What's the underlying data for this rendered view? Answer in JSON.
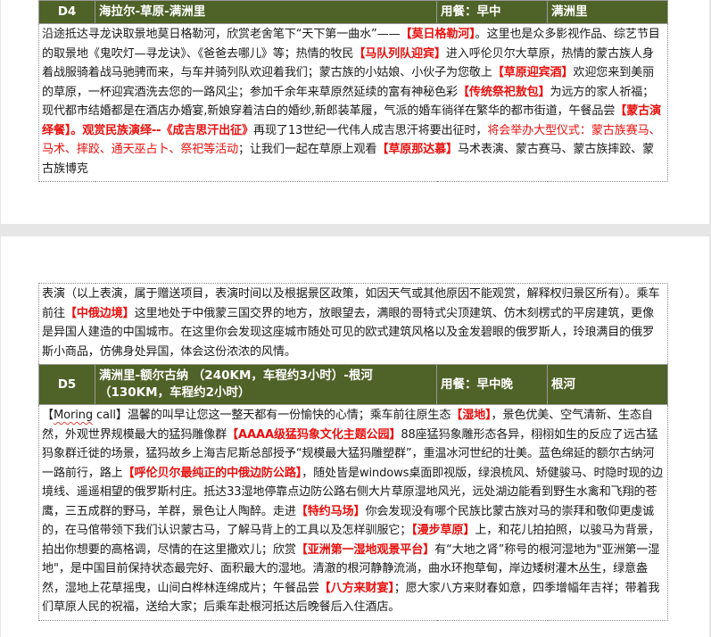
{
  "day4": {
    "day": "D4",
    "route": "海拉尔-草原-满洲里",
    "meals": "用餐：早中",
    "hotel": "满洲里",
    "segments": [
      {
        "t": "沿途抵达寻龙诀取景地莫日格勒河，欣赏老舍笔下“天下第一曲水”——",
        "s": "plain"
      },
      {
        "t": "【莫日格勒河】",
        "s": "hl"
      },
      {
        "t": "。这里也是众多影视作品、综艺节目的取景地《鬼吹灯—寻龙诀》、《爸爸去哪儿》等；热情的牧民",
        "s": "plain"
      },
      {
        "t": "【马队列队迎宾】",
        "s": "hl"
      },
      {
        "t": "进入呼伦贝尔大草原，热情的蒙古族人身着战服骑着战马驰骋而来，与车并骑列队欢迎着我们；蒙古族的小姑娘、小伙子为您敬上",
        "s": "plain"
      },
      {
        "t": "【草原迎宾酒】",
        "s": "hl"
      },
      {
        "t": "欢迎您来到美丽的草原，一杯迎宾酒洗去您的一路风尘；参加千余年来草原然延续的富有神秘色彩",
        "s": "plain"
      },
      {
        "t": "【传统祭祀敖包】",
        "s": "hl"
      },
      {
        "t": "为远方的家人祈福；现代都市结婚都是在酒店办婚宴,新娘穿着洁白的婚纱,新郎装革履，气派的婚车徜徉在繁华的都市街道，午餐品尝",
        "s": "plain"
      },
      {
        "t": "【蒙古演绎餐】",
        "s": "hl"
      },
      {
        "t": "。观赏民族演绎--",
        "s": "hl"
      },
      {
        "t": "《成吉思汗出征》",
        "s": "hl"
      },
      {
        "t": "再现了13世纪一代伟人成吉思汗将要出征时，",
        "s": "plain"
      },
      {
        "t": "将会举办大型仪式：蒙古族赛马、马术、摔跤、通天巫占卜、祭祀等活动",
        "s": "red"
      },
      {
        "t": "；让我们一起在草原上观看",
        "s": "plain"
      },
      {
        "t": "【草原那达慕】",
        "s": "hl"
      },
      {
        "t": "马术表演、蒙古赛马、蒙古族摔跤、蒙古族博克",
        "s": "plain"
      }
    ]
  },
  "day4_cont": {
    "segments": [
      {
        "t": "表演（以上表演，属于赠送项目，表演时间以及根据景区政策，如因天气或其他原因不能观赏，解释权归景区所有）。乘车前往",
        "s": "plain"
      },
      {
        "t": "【中俄边境】",
        "s": "hl"
      },
      {
        "t": "这里地处于中俄蒙三国交界的地方，放眼望去，满眼的哥特式尖顶建筑、仿木刻楞式的平房建筑，更像是异国人建造的中国城市。在这里你会发现这座城市随处可见的欧式建筑风格以及金发碧眼的俄罗斯人，玲琅满目的俄罗斯小商品，仿佛身处异国，体会这份浓浓的风情。",
        "s": "plain"
      }
    ]
  },
  "day5": {
    "day": "D5",
    "route": "满洲里-额尔古纳 （240KM，车程约3小时）-根河（130KM，车程约2小时）",
    "meals": "用餐：早中晚",
    "hotel": "根河",
    "segments": [
      {
        "t": "【",
        "s": "plain"
      },
      {
        "t": "Moring",
        "s": "sq"
      },
      {
        "t": " call】温馨的叫早让您这一整天都有一份愉快的心情；乘车前往原生态",
        "s": "plain"
      },
      {
        "t": "【湿地】",
        "s": "hl"
      },
      {
        "t": "，景色优美、空气清新、生态自然，外观世界规模最大的猛犸雕像群",
        "s": "plain"
      },
      {
        "t": "【AAAA级猛犸象文化主题公园】",
        "s": "hl"
      },
      {
        "t": "88座猛犸象雕形态各异，栩栩如生的反应了远古猛犸象群迁徙的场景，猛犸故乡上海吉尼斯总部授予“规模最大猛犸雕塑群”，重温冰河世纪的壮美。蓝色绵延的额尔古纳河一路前行，路上",
        "s": "plain"
      },
      {
        "t": "【呼伦贝尔最纯正的中俄边防公路】",
        "s": "hl"
      },
      {
        "t": "，随处皆是windows桌面即视版，绿浪梳风、矫健骏马、时隐时现的边境线、遥遥相望的俄罗斯村庄。抵达33湿地停靠点边防公路右侧大片草原湿地风光，远处湖边能看到野生水禽和飞翔的苍鹰，三五成群的野马，羊群，景色让人陶醉。走进",
        "s": "plain"
      },
      {
        "t": "【特约马场】",
        "s": "hl"
      },
      {
        "t": "你会发现没有哪个民族比蒙古族对马的崇拜和敬仰更虔诚的，在马倌带领下我们认识蒙古马，了解马背上的工具以及怎样驯服它；",
        "s": "plain"
      },
      {
        "t": "【漫步草原】",
        "s": "hl"
      },
      {
        "t": "上，和花儿拍拍照，以骏马为背景，拍出你想要的高格调，尽情的在这里撒欢儿；欣赏",
        "s": "plain"
      },
      {
        "t": "【亚洲第一湿地观景平台】",
        "s": "hl"
      },
      {
        "t": "有“大地之肾”称号的根河湿地为\"亚洲第一湿地\"，是中国目前保持状态最完好、面积最大的湿地。清澈的根河静静流淌，曲水环抱草甸，岸边矮树灌木丛生，绿意盎然，湿地上花草摇曳，山间白桦林连绵成片；午餐品尝",
        "s": "plain"
      },
      {
        "t": "【八方来财宴】",
        "s": "hl"
      },
      {
        "t": "；愿大家八方来财春如意，四季增幅年吉祥；带着我们草原人民的祝福，送给大家；后乘车赴根河抵达后晚餐后入住酒店。",
        "s": "plain"
      }
    ]
  }
}
